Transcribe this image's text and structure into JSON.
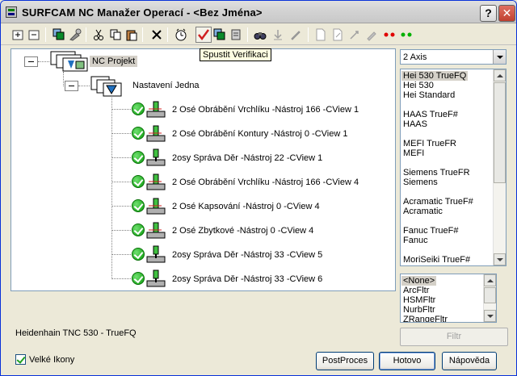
{
  "window": {
    "title": "SURFCAM NC Manažer Operací - <Bez Jména>",
    "help_button": "?",
    "close_button": "✕"
  },
  "toolbar": {
    "tooltip": "Spustit Verifikaci"
  },
  "tree": {
    "root": {
      "label": "NC Projekt"
    },
    "setup": {
      "label": "Nastavení Jedna"
    },
    "operations": [
      {
        "label": "2 Osé Obrábění Vrchlíku  -Nástroj 166 -CView 1"
      },
      {
        "label": "2 Osé Obrábění Kontury  -Nástroj 0 -CView 1"
      },
      {
        "label": "2osy Správa Děr  -Nástroj 22 -CView 1"
      },
      {
        "label": "2 Osé Obrábění Vrchlíku  -Nástroj 166 -CView 4"
      },
      {
        "label": "2 Osé Kapsování  -Nástroj 0 -CView 4"
      },
      {
        "label": "2 Osé Zbytkové  -Nástroj 0 -CView 4"
      },
      {
        "label": "2osy Správa Děr  -Nástroj 33 -CView 5"
      },
      {
        "label": "2osy Správa Děr  -Nástroj 33 -CView 6"
      }
    ]
  },
  "axis_combo": {
    "value": "2 Axis"
  },
  "post_list": {
    "items": [
      "Hei 530 TrueFQ",
      "Hei 530",
      "Hei Standard",
      "",
      "HAAS TrueF#",
      "HAAS",
      "",
      "MEFI TrueFR",
      "MEFI",
      "",
      "Siemens TrueFR",
      "Siemens",
      "",
      "Acramatic TrueF#",
      "Acramatic",
      "",
      "Fanuc TrueF#",
      "Fanuc",
      "",
      "MoriSeiki TrueF#"
    ]
  },
  "filter_list": {
    "items": [
      "<None>",
      "ArcFltr",
      "HSMFltr",
      "NurbFltr",
      "ZRangeFltr"
    ]
  },
  "status": {
    "selected_post": "Heidenhain TNC 530 - TrueFQ"
  },
  "buttons": {
    "filtr": "Filtr",
    "postproces": "PostProces",
    "hotovo": "Hotovo",
    "napoveda": "Nápověda"
  },
  "options": {
    "large_icons_label": "Velké Ikony",
    "large_icons_checked": true
  }
}
